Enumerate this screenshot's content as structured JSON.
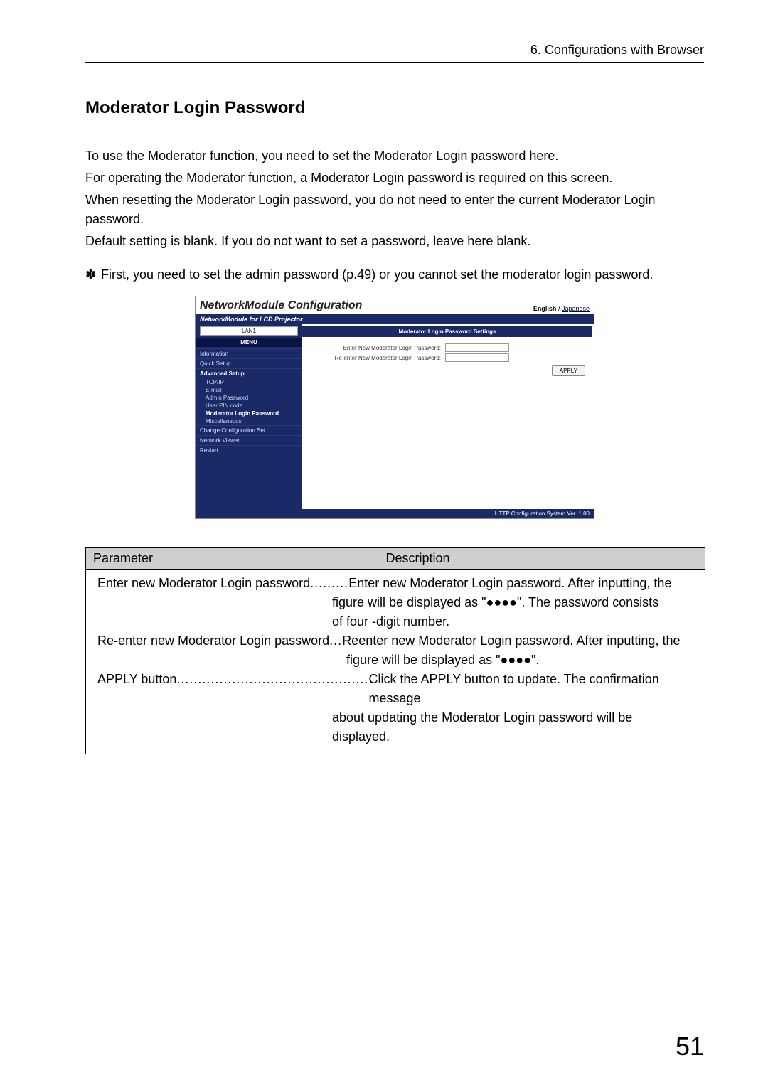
{
  "header": {
    "breadcrumb": "6. Configurations with Browser"
  },
  "section": {
    "title": "Moderator Login Password"
  },
  "paragraphs": {
    "p1": "To use the Moderator function, you need to set the Moderator Login password here.",
    "p2": "For operating the Moderator function, a Moderator Login password is required on this screen.",
    "p3": "When resetting the Moderator Login password, you do not need to enter the current Moderator Login password.",
    "p4": "Default setting is blank. If you do not want to set a password, leave here blank."
  },
  "note": {
    "mark": "✽",
    "text": "First, you need to set the admin password (p.49) or you cannot set the moderator login password."
  },
  "screenshot": {
    "title": "NetworkModule Configuration",
    "lang_en": "English",
    "lang_sep": " / ",
    "lang_jp": "Japanese",
    "subtitle": "NetworkModule for LCD Projector",
    "lan_label": "LAN1",
    "menu_heading": "MENU",
    "sidebar": {
      "information": "Information",
      "quick": "Quick Setup",
      "advanced": "Advanced Setup",
      "tcpip": "TCP/IP",
      "email": "E-mail",
      "adminpw": "Admin Password",
      "userpin": "User PIN code",
      "modpw": "Moderator Login Password",
      "misc": "Miscellaneous",
      "change": "Change Configuration Set",
      "viewer": "Network Viewer",
      "restart": "Restart"
    },
    "panel_head": "Moderator Login Password Settings",
    "field1_label": "Enter New Moderator Login Password:",
    "field2_label": "Re-enter New Moderator Login Password:",
    "apply": "APPLY",
    "footer": "HTTP Configuration System Ver. 1.00"
  },
  "table": {
    "head_param": "Parameter",
    "head_desc": "Description",
    "row1_label": "Enter new Moderator Login password",
    "row1_dots": ".........",
    "row1_desc_a": "Enter new Moderator Login password. After inputting, the",
    "row1_desc_b": "figure will be displayed as \"●●●●\". The password consists",
    "row1_desc_c": "of four -digit number.",
    "row2_label": "Re-enter new Moderator Login password",
    "row2_dots": " ... ",
    "row2_desc_a": "Reenter new Moderator Login password. After inputting, the",
    "row2_desc_b": "figure will be displayed as \"●●●●\".",
    "row3_label": "APPLY button",
    "row3_dots": " .............................................",
    "row3_desc_a": "Click the APPLY button to update. The confirmation message",
    "row3_desc_b": "about updating the Moderator Login password will be",
    "row3_desc_c": "displayed."
  },
  "page_number": "51"
}
